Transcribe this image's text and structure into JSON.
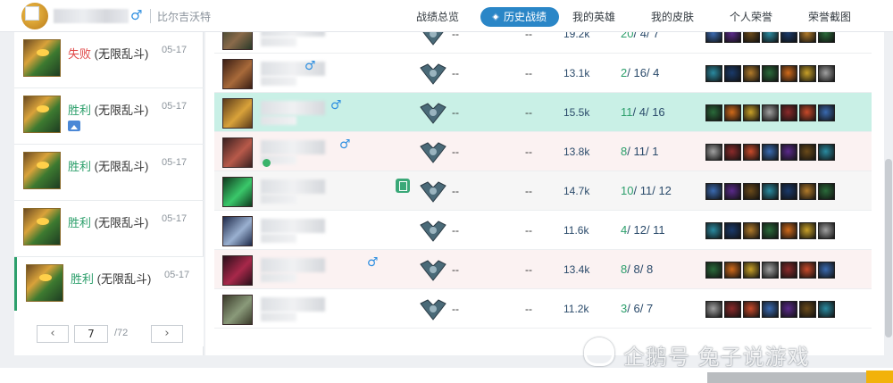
{
  "header": {
    "server": "比尔吉沃特",
    "gender_symbol": "♂",
    "nav": [
      "战绩总览",
      "历史战绩",
      "我的英雄",
      "我的皮肤",
      "个人荣誉",
      "荣誉截图"
    ],
    "active_nav": "历史战绩"
  },
  "match_list": [
    {
      "result": "失败",
      "mode": "(无限乱斗)",
      "date": "05-17",
      "win": false
    },
    {
      "result": "胜利",
      "mode": "(无限乱斗)",
      "date": "05-17",
      "win": true
    },
    {
      "result": "胜利",
      "mode": "(无限乱斗)",
      "date": "05-17",
      "win": true
    },
    {
      "result": "胜利",
      "mode": "(无限乱斗)",
      "date": "05-17",
      "win": true
    },
    {
      "result": "胜利",
      "mode": "(无限乱斗)",
      "date": "05-17",
      "win": true
    }
  ],
  "pager": {
    "prev": "‹",
    "next": "›",
    "current": "7",
    "total": "/72"
  },
  "players": [
    {
      "tier": "--",
      "tier2": "--",
      "damage": "19.2k",
      "k": "20",
      "d": "4",
      "a": "7"
    },
    {
      "tier": "--",
      "tier2": "--",
      "damage": "13.1k",
      "k": "2",
      "d": "16",
      "a": "4"
    },
    {
      "tier": "--",
      "tier2": "--",
      "damage": "15.5k",
      "k": "11",
      "d": "4",
      "a": "16"
    },
    {
      "tier": "--",
      "tier2": "--",
      "damage": "13.8k",
      "k": "8",
      "d": "11",
      "a": "1"
    },
    {
      "tier": "--",
      "tier2": "--",
      "damage": "14.7k",
      "k": "10",
      "d": "11",
      "a": "12"
    },
    {
      "tier": "--",
      "tier2": "--",
      "damage": "11.6k",
      "k": "4",
      "d": "12",
      "a": "11"
    },
    {
      "tier": "--",
      "tier2": "--",
      "damage": "13.4k",
      "k": "8",
      "d": "8",
      "a": "8"
    },
    {
      "tier": "--",
      "tier2": "--",
      "damage": "11.2k",
      "k": "3",
      "d": "6",
      "a": "7"
    }
  ],
  "watermark": "企鹅号 兔子说游戏",
  "colors": {
    "win": "#2c9f6b",
    "lose": "#e04848",
    "active_nav": "#2a86c7",
    "highlight_row": "#c9f0e6"
  }
}
